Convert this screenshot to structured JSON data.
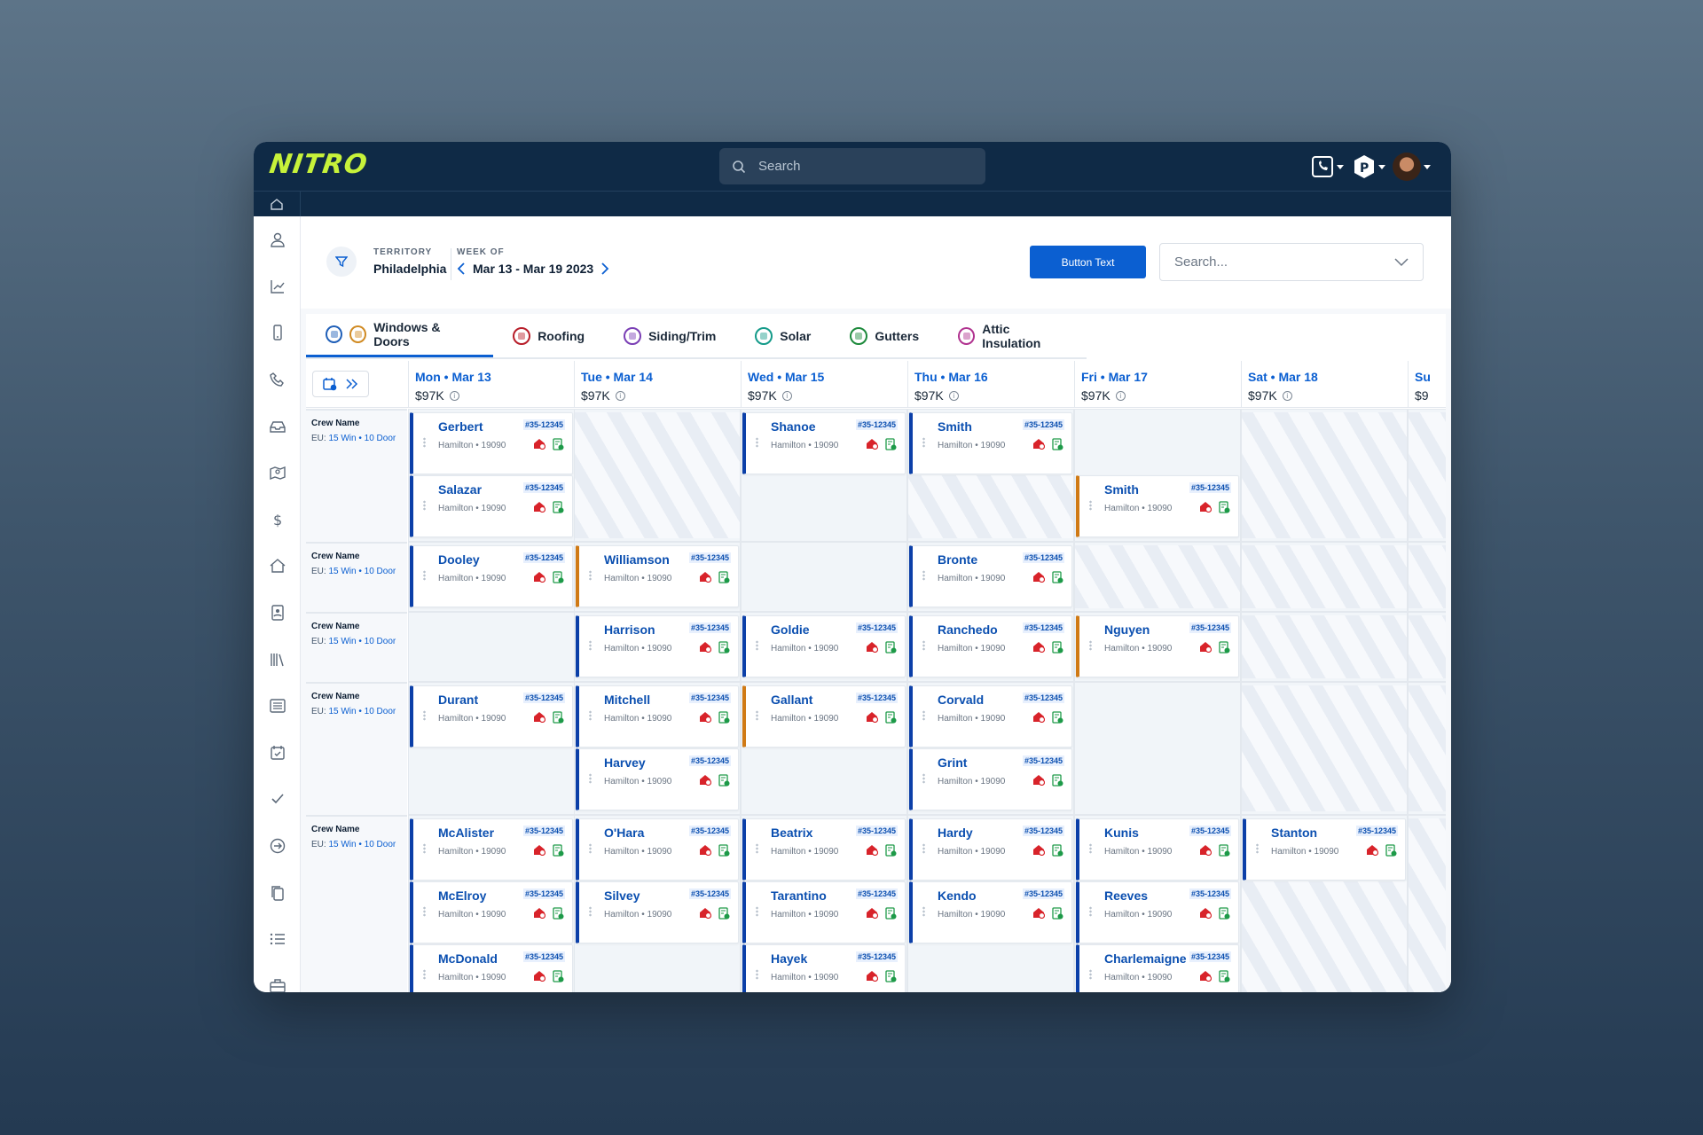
{
  "app": {
    "logo": "NITRO"
  },
  "topbar": {
    "search_placeholder": "Search"
  },
  "toolbar": {
    "territory_label": "TERRITORY",
    "territory": "Philadelphia",
    "week_label": "WEEK OF",
    "week_range": "Mar 13 - Mar 19 2023",
    "button_label": "Button Text",
    "select_placeholder": "Search..."
  },
  "tabs": [
    {
      "label": "Windows & Doors",
      "color": "#1f5fb8"
    },
    {
      "label": "Roofing",
      "color": "#b81e2a"
    },
    {
      "label": "Siding/Trim",
      "color": "#7a3fb5"
    },
    {
      "label": "Solar",
      "color": "#159b8a"
    },
    {
      "label": "Gutters",
      "color": "#1d8a3c"
    },
    {
      "label": "Attic Insulation",
      "color": "#b0328f"
    }
  ],
  "days": [
    {
      "day": "Mon •",
      "date": "Mar 13",
      "amount": "$97K"
    },
    {
      "day": "Tue •",
      "date": "Mar 14",
      "amount": "$97K"
    },
    {
      "day": "Wed •",
      "date": "Mar 15",
      "amount": "$97K"
    },
    {
      "day": "Thu •",
      "date": "Mar 16",
      "amount": "$97K"
    },
    {
      "day": "Fri •",
      "date": "Mar 17",
      "amount": "$97K"
    },
    {
      "day": "Sat •",
      "date": "Mar 18",
      "amount": "$97K"
    },
    {
      "day": "Su",
      "date": "",
      "amount": "$9"
    }
  ],
  "crew": {
    "name": "Crew Name",
    "eu_prefix": "EU:",
    "eu_detail": "15 Win • 10 Door"
  },
  "card_defaults": {
    "job_id": "#35-12345",
    "location": "Hamilton • 19090"
  },
  "jobs": [
    {
      "name": "Gerbert"
    },
    {
      "name": "Salazar"
    },
    {
      "name": "Shanoe"
    },
    {
      "name": "Smith"
    },
    {
      "name": "Smith"
    },
    {
      "name": "Dooley"
    },
    {
      "name": "Williamson"
    },
    {
      "name": "Bronte"
    },
    {
      "name": "Harrison"
    },
    {
      "name": "Goldie"
    },
    {
      "name": "Ranchedo"
    },
    {
      "name": "Nguyen"
    },
    {
      "name": "Durant"
    },
    {
      "name": "Mitchell"
    },
    {
      "name": "Gallant"
    },
    {
      "name": "Corvald"
    },
    {
      "name": "Harvey"
    },
    {
      "name": "Grint"
    },
    {
      "name": "McAlister"
    },
    {
      "name": "O'Hara"
    },
    {
      "name": "Beatrix"
    },
    {
      "name": "Hardy"
    },
    {
      "name": "Kunis"
    },
    {
      "name": "Stanton"
    },
    {
      "name": "McElroy"
    },
    {
      "name": "Silvey"
    },
    {
      "name": "Tarantino"
    },
    {
      "name": "Kendo"
    },
    {
      "name": "Reeves"
    },
    {
      "name": "McDonald"
    },
    {
      "name": "Hayek"
    },
    {
      "name": "Charlemaigne"
    }
  ]
}
